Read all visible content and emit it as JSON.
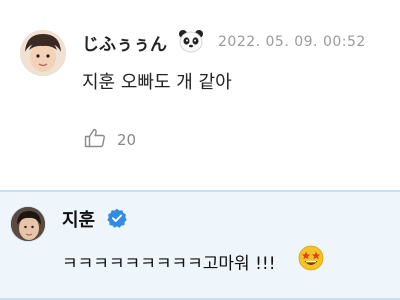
{
  "fan_comment": {
    "username": "じふぅぅん",
    "username_icon": "panda-icon",
    "timestamp": "2022. 05. 09. 00:52",
    "text": "지훈 오빠도 개 같아",
    "like_icon": "thumbs-up-icon",
    "like_count": "20"
  },
  "artist_reply": {
    "name": "지훈",
    "badge_icon": "verified-check-icon",
    "text": "ㅋㅋㅋㅋㅋㅋㅋㅋㅋ고마워 !!!",
    "emoji_icon": "star-struck-emoji-icon"
  },
  "colors": {
    "reply_background": "#eef6fc",
    "reply_border": "#c6e1f3",
    "verified_blue": "#2f8be3",
    "timestamp_gray": "#9a9a9a"
  }
}
